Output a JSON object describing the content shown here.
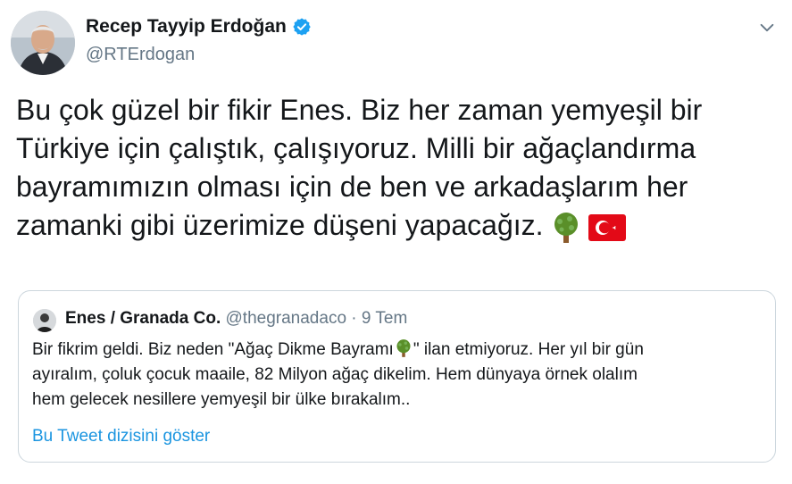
{
  "author": {
    "name": "Recep Tayyip Erdoğan",
    "handle": "@RTErdogan",
    "verified": true
  },
  "tweet": {
    "text": "Bu çok güzel bir fikir Enes. Biz her zaman yemyeşil bir\nTürkiye için çalıştık, çalışıyoruz. Milli bir ağaçlandırma\nbayramımızın olması için de ben ve arkadaşlarım her\nzamanki gibi üzerimize düşeni yapacağız.",
    "emojis": [
      "deciduous-tree-emoji",
      "turkey-flag-emoji"
    ]
  },
  "quoted": {
    "name": "Enes / Granada Co.",
    "handle": "@thegranadaco",
    "separator": " · ",
    "date": "9 Tem",
    "text_before_emoji": "Bir fikrim geldi. Biz neden \"Ağaç Dikme Bayramı",
    "text_after_emoji": "\" ilan etmiyoruz. Her yıl bir gün\nayıralım, çoluk çocuk maaile, 82 Milyon ağaç dikelim. Hem dünyaya örnek olalım\nhem gelecek nesillere yemyeşil bir ülke bırakalım..",
    "thread_link": "Bu Tweet dizisini göster"
  },
  "colors": {
    "text": "#14171a",
    "secondary": "#657786",
    "link": "#1b95e0",
    "border": "#ccd6dd",
    "verified": "#1da1f2"
  }
}
